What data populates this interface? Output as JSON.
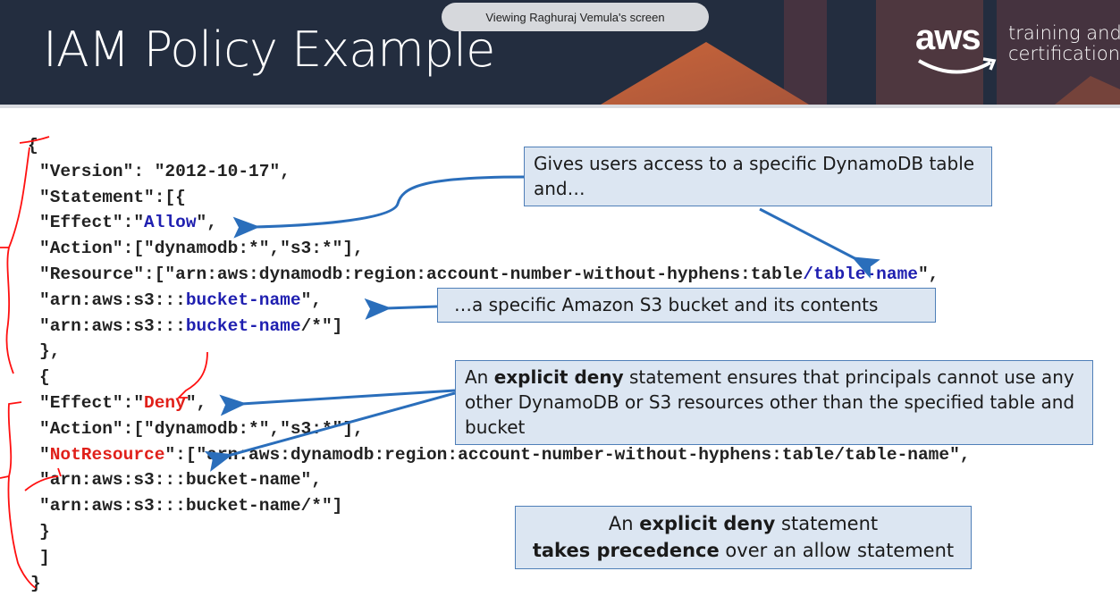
{
  "screen_share": {
    "banner": "Viewing Raghuraj Vemula's screen"
  },
  "slide": {
    "title": "IAM Policy Example",
    "logo": {
      "wordmark": "aws",
      "line1": "training and",
      "line2": "certification"
    },
    "colors": {
      "header_bg": "#232d3f",
      "code_blue": "#1f1fb0",
      "code_red": "#e0201a",
      "callout_bg": "#dce6f2",
      "callout_border": "#4f7fb8",
      "arrow": "#2a6ebb",
      "annotation_red": "#ff0000"
    },
    "code_lines": [
      {
        "indent": "outer",
        "segments": [
          {
            "t": "{"
          }
        ]
      },
      {
        "segments": [
          {
            "t": "\"Version\": \"2012-10-17\","
          }
        ]
      },
      {
        "segments": [
          {
            "t": "\"Statement\":[{"
          }
        ]
      },
      {
        "segments": [
          {
            "t": "\"Effect\":\""
          },
          {
            "t": "Allow",
            "c": "blue"
          },
          {
            "t": "\","
          }
        ]
      },
      {
        "segments": [
          {
            "t": "\"Action\":[\"dynamodb:*\",\"s3:*\"],"
          }
        ]
      },
      {
        "segments": [
          {
            "t": "\"Resource\":[\"arn:aws:dynamodb:region:account-number-without-hyphens:table"
          },
          {
            "t": "/table-name",
            "c": "blue"
          },
          {
            "t": "\","
          }
        ]
      },
      {
        "segments": [
          {
            "t": "\"arn:aws:s3:::"
          },
          {
            "t": "bucket-name",
            "c": "blue"
          },
          {
            "t": "\","
          }
        ]
      },
      {
        "segments": [
          {
            "t": "\"arn:aws:s3:::"
          },
          {
            "t": "bucket-name",
            "c": "blue"
          },
          {
            "t": "/*\"]"
          }
        ]
      },
      {
        "segments": [
          {
            "t": "},"
          }
        ]
      },
      {
        "segments": [
          {
            "t": "{"
          }
        ]
      },
      {
        "segments": [
          {
            "t": "\"Effect\":\""
          },
          {
            "t": "Deny",
            "c": "red"
          },
          {
            "t": "\","
          }
        ]
      },
      {
        "segments": [
          {
            "t": "\"Action\":[\"dynamodb:*\",\"s3:*\"],"
          }
        ]
      },
      {
        "segments": [
          {
            "t": "\""
          },
          {
            "t": "NotResource",
            "c": "red"
          },
          {
            "t": "\":[\"arn:aws:dynamodb:region:account-number-without-hyphens:table/table-name\","
          }
        ]
      },
      {
        "segments": [
          {
            "t": "\"arn:aws:s3:::bucket-name\","
          }
        ]
      },
      {
        "segments": [
          {
            "t": "\"arn:aws:s3:::bucket-name/*\"]"
          }
        ]
      },
      {
        "segments": [
          {
            "t": "}"
          }
        ]
      },
      {
        "segments": [
          {
            "t": "]"
          }
        ]
      },
      {
        "indent": "outer",
        "segments": [
          {
            "t": "}"
          }
        ]
      }
    ],
    "callouts": {
      "dynamodb": {
        "text": "Gives users access to a specific DynamoDB table and…"
      },
      "s3": {
        "text": "…a specific Amazon S3 bucket and its contents"
      },
      "deny": {
        "pre": "An ",
        "bold": "explicit deny",
        "post": " statement ensures that principals cannot use any other DynamoDB or S3 resources other than the specified table and bucket"
      },
      "precedence": {
        "pre": "An ",
        "bold": "explicit deny",
        "post": " statement",
        "bold2": "takes precedence",
        "post2": " over an allow statement"
      }
    }
  }
}
